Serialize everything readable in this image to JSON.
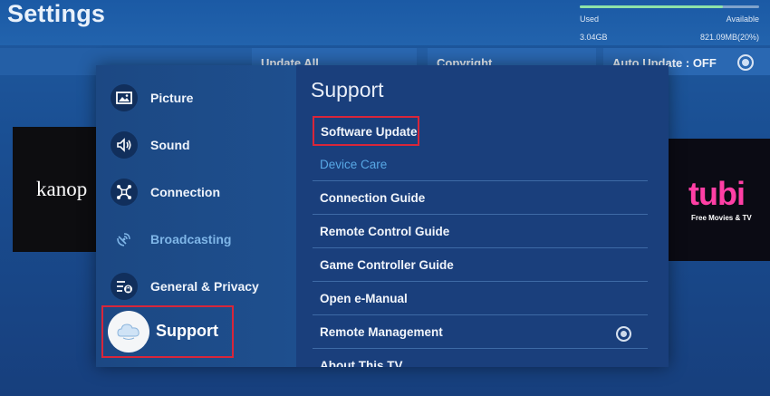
{
  "header": {
    "title": "Settings",
    "storage": {
      "used_label": "Used",
      "available_label": "Available",
      "used_value": "3.04GB",
      "available_value": "821.09MB(20%)",
      "used_fraction": 0.8
    }
  },
  "background": {
    "update_all_label": "Update All",
    "copyright_label": "Copyright",
    "auto_update_label": "Auto Update : OFF",
    "tiles": {
      "kanopy": "kanop",
      "tubi_logo": "tubi",
      "tubi_tagline": "Free Movies & TV"
    }
  },
  "sidebar": {
    "items": [
      {
        "label": "Picture",
        "icon": "picture-icon"
      },
      {
        "label": "Sound",
        "icon": "sound-icon"
      },
      {
        "label": "Connection",
        "icon": "connection-icon"
      },
      {
        "label": "Broadcasting",
        "icon": "broadcasting-icon"
      },
      {
        "label": "General & Privacy",
        "icon": "general-icon"
      },
      {
        "label": "Support",
        "icon": "support-icon",
        "selected": true
      }
    ]
  },
  "support": {
    "title": "Support",
    "items": [
      {
        "label": "Software Update",
        "selected": true
      },
      {
        "label": "Device Care",
        "dimmed": true
      },
      {
        "label": "Connection Guide"
      },
      {
        "label": "Remote Control Guide"
      },
      {
        "label": "Game Controller Guide"
      },
      {
        "label": "Open e-Manual"
      },
      {
        "label": "Remote Management"
      },
      {
        "label": "About This TV"
      }
    ]
  },
  "colors": {
    "highlight_border": "#d8263a",
    "dimmed_text": "#58a8e6",
    "tubi_pink": "#ff3fa5"
  }
}
